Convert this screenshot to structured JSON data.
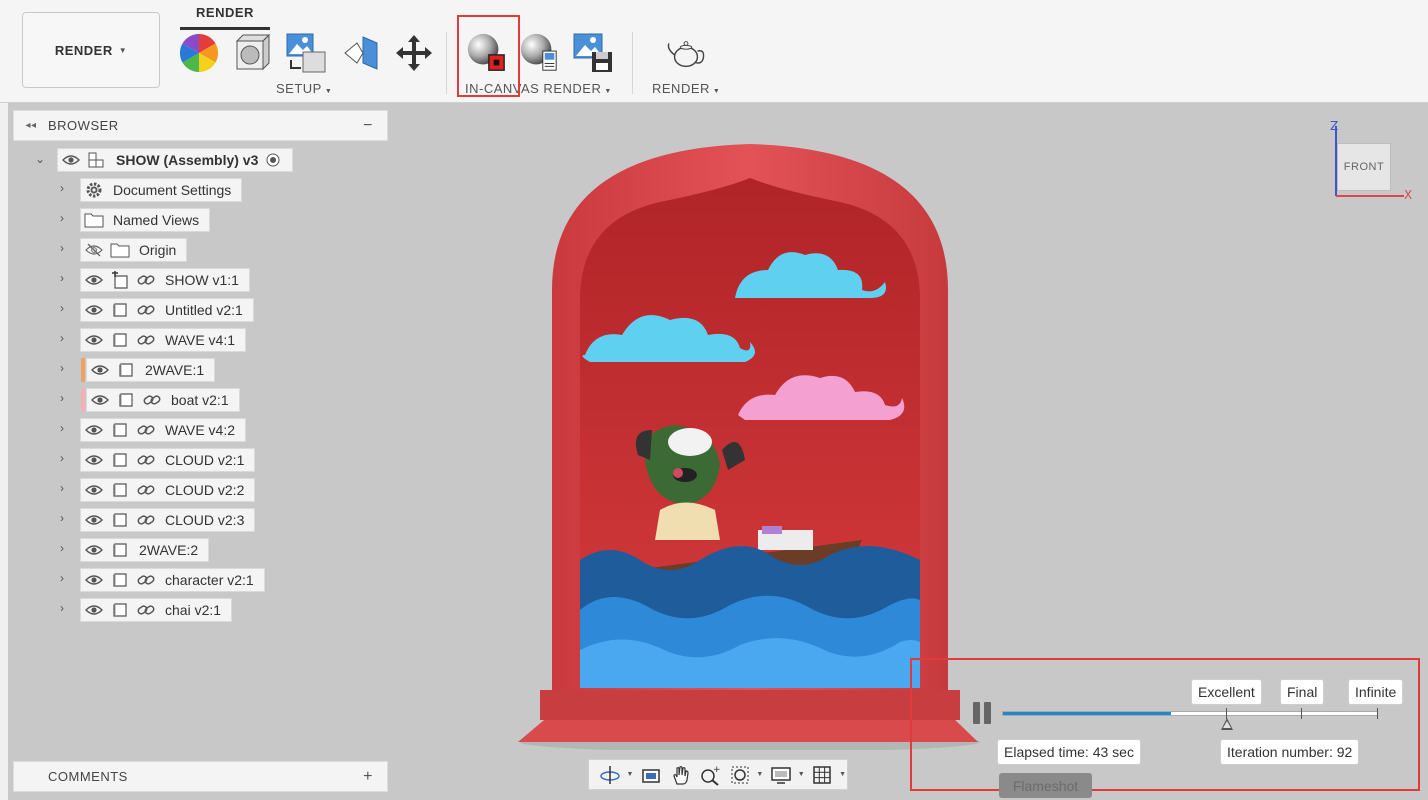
{
  "toolbar": {
    "workspace": "RENDER",
    "tab": "RENDER",
    "groups": {
      "setup": "SETUP",
      "in_canvas": "IN-CANVAS RENDER",
      "render": "RENDER"
    },
    "tools": [
      {
        "icon": "color-wheel-icon"
      },
      {
        "icon": "scene-settings-icon"
      },
      {
        "icon": "texture-map-icon"
      },
      {
        "icon": "decal-icon"
      },
      {
        "icon": "move-icon"
      },
      {
        "icon": "stop-render-icon"
      },
      {
        "icon": "render-settings-icon"
      },
      {
        "icon": "capture-image-icon"
      },
      {
        "icon": "teapot-icon"
      }
    ]
  },
  "browser": {
    "title": "BROWSER",
    "root": "SHOW (Assembly) v3",
    "items": [
      {
        "label": "Document Settings",
        "icon": "gear-icon"
      },
      {
        "label": "Named Views",
        "icon": "folder-icon"
      },
      {
        "label": "Origin",
        "icon": "folder-icon",
        "hidden": true
      },
      {
        "label": "SHOW v1:1",
        "icon": "component-icon"
      },
      {
        "label": "Untitled v2:1",
        "icon": "component-icon"
      },
      {
        "label": "WAVE v4:1",
        "icon": "component-icon"
      },
      {
        "label": "2WAVE:1",
        "icon": "component-icon",
        "tag": "#f0a060"
      },
      {
        "label": "boat v2:1",
        "icon": "component-icon",
        "tag": "#f4b0b8"
      },
      {
        "label": "WAVE v4:2",
        "icon": "component-icon"
      },
      {
        "label": "CLOUD v2:1",
        "icon": "component-icon"
      },
      {
        "label": "CLOUD v2:2",
        "icon": "component-icon"
      },
      {
        "label": "CLOUD v2:3",
        "icon": "component-icon"
      },
      {
        "label": "2WAVE:2",
        "icon": "component-icon"
      },
      {
        "label": "character v2:1",
        "icon": "component-icon"
      },
      {
        "label": "chai v2:1",
        "icon": "component-icon"
      }
    ]
  },
  "comments": {
    "title": "COMMENTS"
  },
  "viewcube": {
    "face": "FRONT",
    "axis_z": "Z",
    "axis_x": "X"
  },
  "render_progress": {
    "progress": 0.45,
    "levels": [
      "Excellent",
      "Final",
      "Infinite"
    ],
    "elapsed": "Elapsed time: 43 sec",
    "iteration": "Iteration number: 92"
  },
  "overlay": {
    "flameshot": "Flameshot"
  }
}
